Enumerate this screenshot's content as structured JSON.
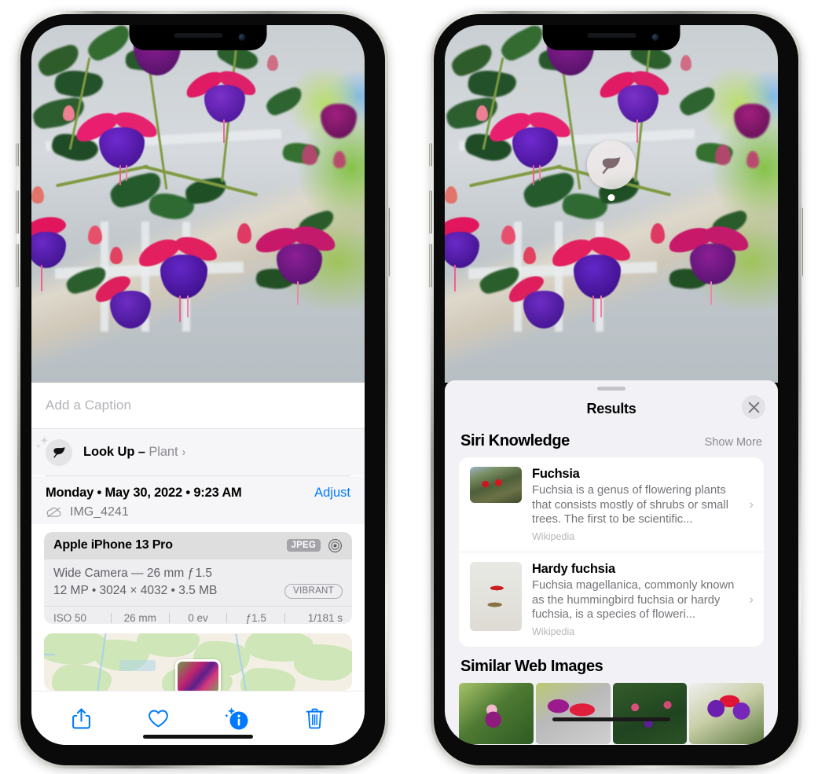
{
  "left_phone": {
    "name": "photos-detail-view",
    "caption": {
      "placeholder": "Add a Caption",
      "value": ""
    },
    "lookup": {
      "icon": "leaf-icon",
      "label": "Look Up –",
      "subject": "Plant",
      "chevron": "›"
    },
    "meta": {
      "date": "Monday • May 30, 2022 • 9:23 AM",
      "adjust_label": "Adjust",
      "cloud_icon": "icloud-slash-icon",
      "filename": "IMG_4241"
    },
    "camera": {
      "model": "Apple iPhone 13 Pro",
      "format_badge": "JPEG",
      "raw_icon": "aperture-icon",
      "lens": "Wide Camera — 26 mm ƒ 1.5",
      "specs": "12 MP • 3024 × 4032 • 3.5 MB",
      "style_badge": "VIBRANT",
      "exif": [
        "ISO 50",
        "26 mm",
        "0 ev",
        "ƒ1.5",
        "1/181 s"
      ]
    },
    "toolbar": [
      {
        "name": "share-button",
        "icon": "share-icon"
      },
      {
        "name": "favorite-button",
        "icon": "heart-icon"
      },
      {
        "name": "info-button",
        "icon": "info-sparkle-icon"
      },
      {
        "name": "delete-button",
        "icon": "trash-icon"
      }
    ],
    "photo_alt": "Close-up of pink and purple fuchsia flowers hanging from a basket on a porch"
  },
  "right_phone": {
    "name": "visual-look-up-results",
    "badge": {
      "icon": "leaf-icon",
      "label": "visual-look-up-badge"
    },
    "sheet": {
      "grabber": "drag-handle",
      "title": "Results",
      "close_icon": "close-icon"
    },
    "siri_knowledge": {
      "title": "Siri Knowledge",
      "show_more": "Show More",
      "items": [
        {
          "title": "Fuchsia",
          "description": "Fuchsia is a genus of flowering plants that consists mostly of shrubs or small trees. The first to be scientific...",
          "source": "Wikipedia",
          "thumb": "fuchsia-red-flowers-thumb",
          "chevron": "›"
        },
        {
          "title": "Hardy fuchsia",
          "description": "Fuchsia magellanica, commonly known as the hummingbird fuchsia or hardy fuchsia, is a species of floweri...",
          "source": "Wikipedia",
          "thumb": "hardy-fuchsia-branch-thumb",
          "chevron": "›"
        }
      ]
    },
    "similar_web_images": {
      "title": "Similar Web Images",
      "items": [
        {
          "name": "web-image-1",
          "alt": "Magenta fuchsia bloom among green leaves"
        },
        {
          "name": "web-image-2",
          "alt": "Close-up red and purple fuchsia petals"
        },
        {
          "name": "web-image-3",
          "alt": "Fuchsia shrub with many buds"
        },
        {
          "name": "web-image-4",
          "alt": "Purple and red double fuchsia flowers"
        }
      ]
    }
  },
  "colors": {
    "accent_blue": "#007AFF",
    "sheet_bg": "#F2F2F6",
    "card_bg": "#FFFFFF",
    "panel_bg": "#F6F6F8",
    "secondary_text": "#76767C",
    "badge_gray": "#A3A3A8"
  }
}
